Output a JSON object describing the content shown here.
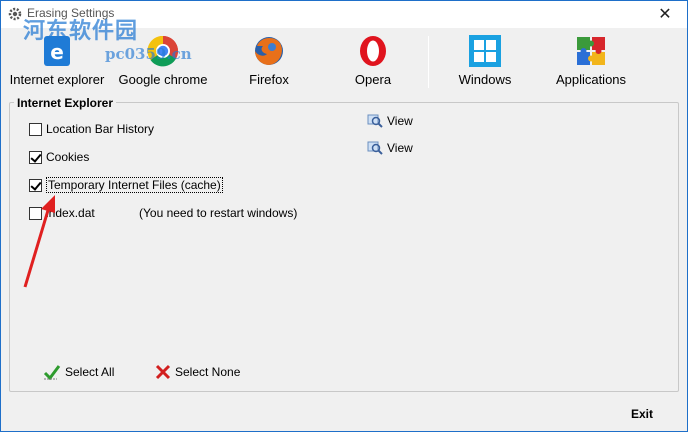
{
  "window": {
    "title": "Erasing Settings",
    "close_glyph": "✕"
  },
  "watermark": {
    "text": "河东软件园",
    "url": "pc0359.cn"
  },
  "toolbar": {
    "items": [
      {
        "label": "Internet explorer",
        "icon": "internet-explorer-icon"
      },
      {
        "label": "Google chrome",
        "icon": "chrome-icon"
      },
      {
        "label": "Firefox",
        "icon": "firefox-icon"
      },
      {
        "label": "Opera",
        "icon": "opera-icon"
      },
      {
        "label": "Windows",
        "icon": "windows-icon"
      },
      {
        "label": "Applications",
        "icon": "puzzle-icon"
      }
    ]
  },
  "panel": {
    "title": "Internet Explorer",
    "options": [
      {
        "label": "Location Bar History",
        "checked": false
      },
      {
        "label": "Cookies",
        "checked": true
      },
      {
        "label": "Temporary Internet Files (cache)",
        "checked": true
      },
      {
        "label": "index.dat",
        "checked": false
      }
    ],
    "note": "(You need to restart windows)",
    "view_label": "View"
  },
  "actions": {
    "select_all": "Select All",
    "select_none": "Select None",
    "exit": "Exit"
  },
  "colors": {
    "accent": "#1e6fc9",
    "arrow": "#e02020"
  }
}
